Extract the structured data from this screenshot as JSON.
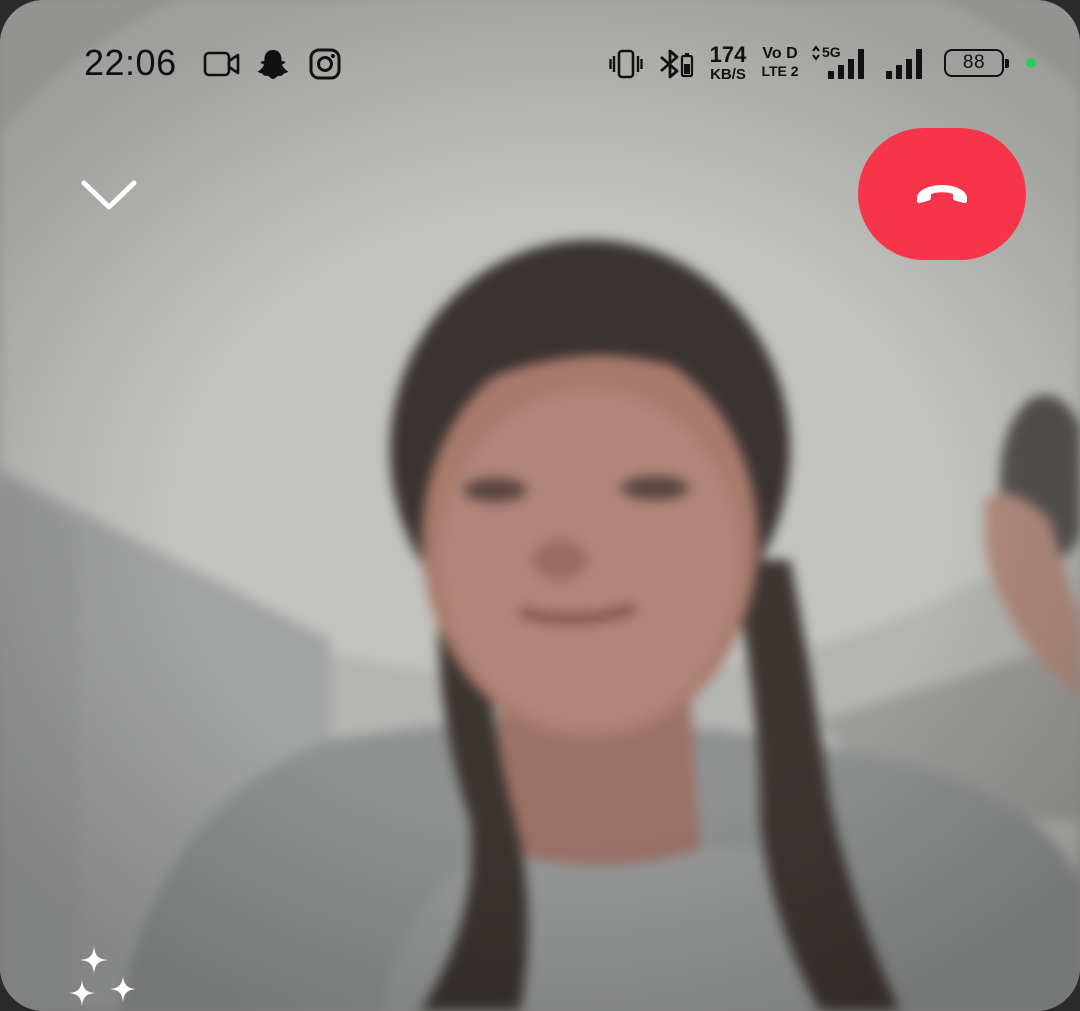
{
  "status_bar": {
    "time": "22:06",
    "network_speed": "174",
    "network_speed_unit": "KB/S",
    "volte_top": "Vo D",
    "volte_bottom": "LTE 2",
    "signal_label": "5G",
    "battery_level": "88",
    "notification_icons": [
      "video-camera-icon",
      "snapchat-icon",
      "instagram-icon"
    ],
    "system_icons": [
      "vibrate-icon",
      "bluetooth-battery-icon",
      "volte-icon",
      "signal-5g-icon",
      "signal-icon",
      "battery-icon"
    ],
    "indicator_color": "#2ECC55"
  },
  "call_controls": {
    "minimize_icon": "chevron-down-icon",
    "end_call_icon": "hang-up-phone-icon",
    "end_call_color": "#F7354A",
    "effects_icon": "sparkles-icon"
  }
}
